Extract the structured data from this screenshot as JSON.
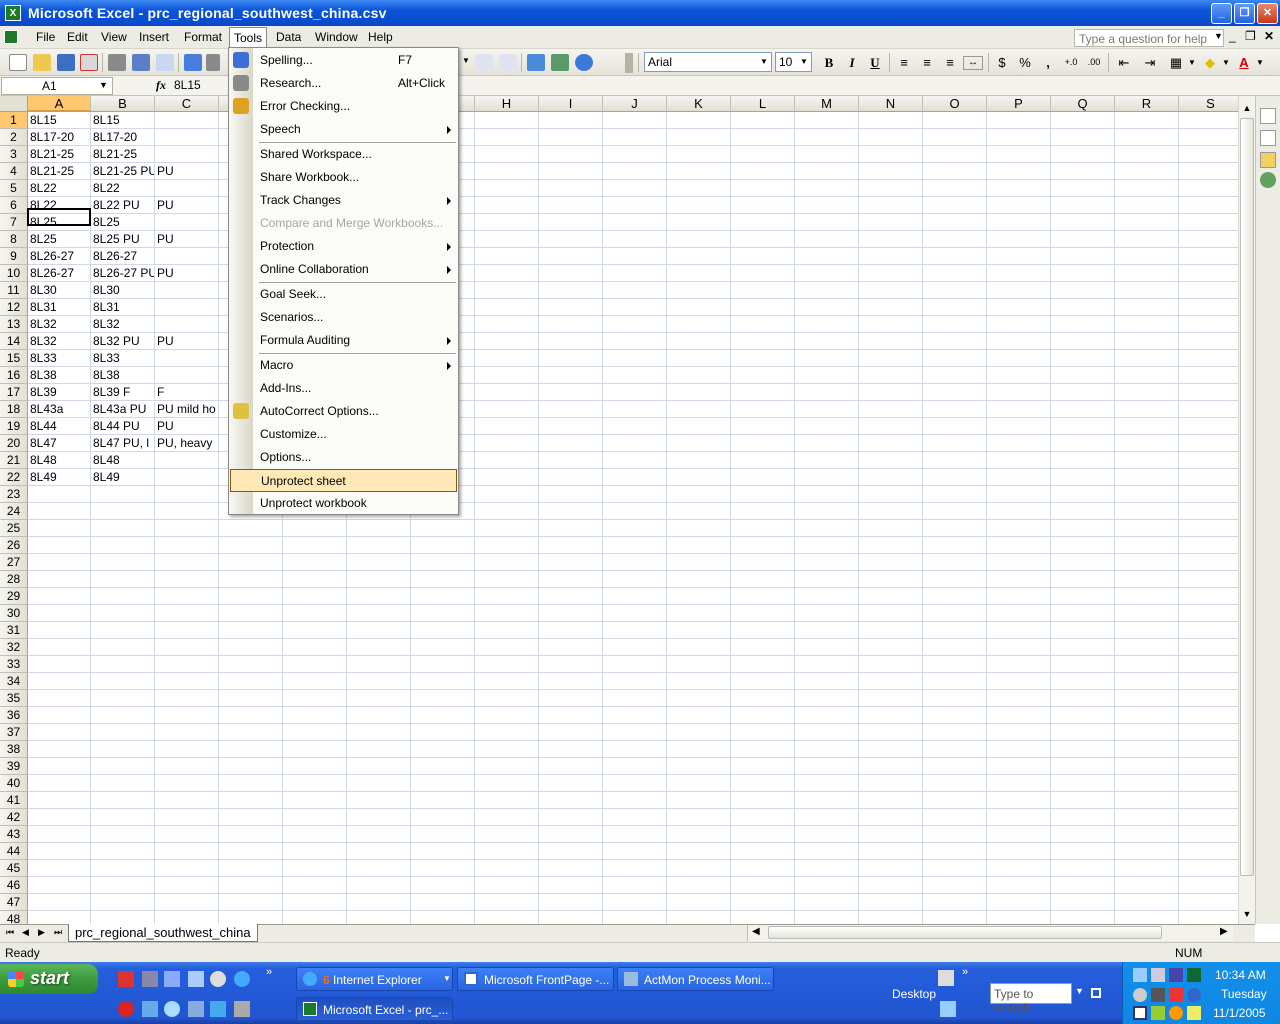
{
  "window": {
    "title": "Microsoft Excel - prc_regional_southwest_china.csv"
  },
  "menubar": {
    "items": [
      "File",
      "Edit",
      "View",
      "Insert",
      "Format",
      "Tools",
      "Data",
      "Window",
      "Help"
    ],
    "help_placeholder": "Type a question for help"
  },
  "toolbar": {
    "font": "Arial",
    "font_size": "10",
    "bold": "B",
    "italic": "I",
    "underline": "U",
    "currency": "$",
    "percent": "%",
    "comma": ","
  },
  "formula": {
    "namebox": "A1",
    "fx": "fx",
    "value": "8L15"
  },
  "columns": [
    "A",
    "B",
    "C",
    "D",
    "E",
    "F",
    "G",
    "H",
    "I",
    "J",
    "K",
    "L",
    "M",
    "N",
    "O",
    "P",
    "Q",
    "R",
    "S"
  ],
  "rows": [
    "1",
    "2",
    "3",
    "4",
    "5",
    "6",
    "7",
    "8",
    "9",
    "10",
    "11",
    "12",
    "13",
    "14",
    "15",
    "16",
    "17",
    "18",
    "19",
    "20",
    "21",
    "22",
    "23",
    "24",
    "25",
    "26",
    "27",
    "28",
    "29",
    "30",
    "31",
    "32",
    "33",
    "34",
    "35",
    "36",
    "37",
    "38",
    "39",
    "40",
    "41",
    "42",
    "43",
    "44",
    "45",
    "46",
    "47",
    "48"
  ],
  "cells": [
    [
      "8L15",
      "8L15",
      ""
    ],
    [
      "8L17-20",
      "8L17-20",
      ""
    ],
    [
      "8L21-25",
      "8L21-25",
      ""
    ],
    [
      "8L21-25",
      "8L21-25 PU",
      "PU"
    ],
    [
      "8L22",
      "8L22",
      ""
    ],
    [
      "8L22",
      "8L22 PU",
      "PU"
    ],
    [
      "8L25",
      "8L25",
      ""
    ],
    [
      "8L25",
      "8L25 PU",
      "PU"
    ],
    [
      "8L26-27",
      "8L26-27",
      ""
    ],
    [
      "8L26-27",
      "8L26-27 PU",
      "PU"
    ],
    [
      "8L30",
      "8L30",
      ""
    ],
    [
      "8L31",
      "8L31",
      ""
    ],
    [
      "8L32",
      "8L32",
      ""
    ],
    [
      "8L32",
      "8L32 PU",
      "PU"
    ],
    [
      "8L33",
      "8L33",
      ""
    ],
    [
      "8L38",
      "8L38",
      ""
    ],
    [
      "8L39",
      "8L39 F",
      "F"
    ],
    [
      "8L43a",
      "8L43a PU",
      "PU mild ho"
    ],
    [
      "8L44",
      "8L44 PU",
      "PU"
    ],
    [
      "8L47",
      "8L47 PU, l",
      "PU, heavy"
    ],
    [
      "8L48",
      "8L48",
      ""
    ],
    [
      "8L49",
      "8L49",
      ""
    ]
  ],
  "tools_menu": [
    {
      "label": "Spelling...",
      "shortcut": "F7",
      "icon": "spelling-icon"
    },
    {
      "label": "Research...",
      "shortcut": "Alt+Click",
      "icon": "research-icon"
    },
    {
      "label": "Error Checking...",
      "icon": "error-checking-icon"
    },
    {
      "label": "Speech",
      "submenu": true
    },
    {
      "sep": true
    },
    {
      "label": "Shared Workspace..."
    },
    {
      "label": "Share Workbook..."
    },
    {
      "label": "Track Changes",
      "submenu": true
    },
    {
      "label": "Compare and Merge Workbooks...",
      "disabled": true
    },
    {
      "label": "Protection",
      "submenu": true
    },
    {
      "label": "Online Collaboration",
      "submenu": true
    },
    {
      "sep": true
    },
    {
      "label": "Goal Seek..."
    },
    {
      "label": "Scenarios..."
    },
    {
      "label": "Formula Auditing",
      "submenu": true
    },
    {
      "sep": true
    },
    {
      "label": "Macro",
      "submenu": true
    },
    {
      "label": "Add-Ins..."
    },
    {
      "label": "AutoCorrect Options...",
      "icon": "autocorrect-icon"
    },
    {
      "label": "Customize..."
    },
    {
      "label": "Options..."
    },
    {
      "label": "Unprotect sheet",
      "highlighted": true
    },
    {
      "label": "Unprotect workbook"
    }
  ],
  "sheet_tab": "prc_regional_southwest_china",
  "status": {
    "left": "Ready",
    "num": "NUM"
  },
  "taskbar": {
    "start": "start",
    "tasks": [
      {
        "label": "Internet Explorer",
        "count": "6",
        "icon": "ie-icon"
      },
      {
        "label": "Microsoft FrontPage -...",
        "icon": "frontpage-icon"
      },
      {
        "label": "ActMon Process Moni...",
        "icon": "actmon-icon"
      },
      {
        "label": "Microsoft Excel - prc_...",
        "icon": "excel-icon",
        "active": true
      }
    ],
    "desktop": "Desktop",
    "search_placeholder": "Type to search",
    "clock": {
      "time": "10:34 AM",
      "day": "Tuesday",
      "date": "11/1/2005"
    }
  },
  "colors": {
    "title_blue": "#0b54d8",
    "selected_header": "#ffc870",
    "menu_highlight": "#fde8b6",
    "taskbar": "#245edb",
    "start_green": "#3d9b3d"
  }
}
